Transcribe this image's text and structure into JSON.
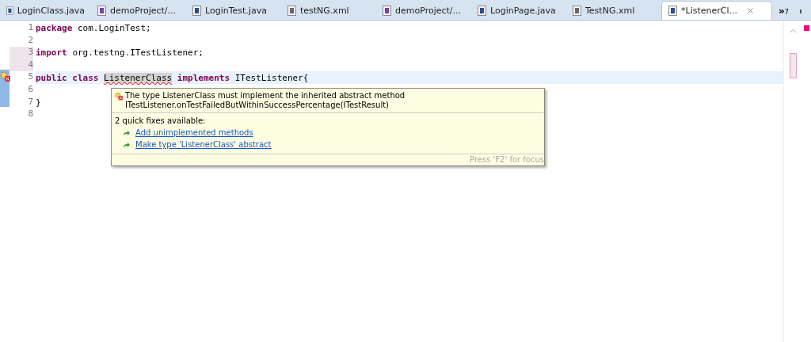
{
  "tabs": [
    {
      "label": "LoginClass.java",
      "kind": "java",
      "selected": false
    },
    {
      "label": "demoProject/...",
      "kind": "maven",
      "selected": false
    },
    {
      "label": "LoginTest.java",
      "kind": "java",
      "selected": false
    },
    {
      "label": "testNG.xml",
      "kind": "xml",
      "selected": false
    },
    {
      "label": "demoProject/...",
      "kind": "maven",
      "selected": false
    },
    {
      "label": "LoginPage.java",
      "kind": "java",
      "selected": false
    },
    {
      "label": "TestNG.xml",
      "kind": "xml",
      "selected": false
    },
    {
      "label": "*ListenerCl...",
      "kind": "java",
      "selected": true
    }
  ],
  "overflow": {
    "symbol": "»",
    "count": "7"
  },
  "lines": [
    {
      "number": "1",
      "tokens": [
        {
          "text": "package",
          "kind": "keyword"
        },
        {
          "text": "com.LoginTest;",
          "kind": "plain"
        }
      ]
    },
    {
      "number": "2"
    },
    {
      "number": "3",
      "tokens": [
        {
          "text": "import",
          "kind": "keyword"
        },
        {
          "text": "org.testng.ITestListener;",
          "kind": "plain"
        }
      ]
    },
    {
      "number": "4"
    },
    {
      "number": "5",
      "current": true,
      "error": true,
      "tokens": [
        {
          "text": "public class",
          "kind": "keyword"
        },
        {
          "text": "ListenerClass",
          "kind": "error"
        },
        {
          "text": "implements",
          "kind": "keyword"
        },
        {
          "text": "ITestListener{",
          "kind": "plain"
        }
      ]
    },
    {
      "number": "6"
    },
    {
      "number": "7",
      "tokens": [
        {
          "text": "}",
          "kind": "plain"
        }
      ]
    },
    {
      "number": "8"
    }
  ],
  "popup": {
    "message": "The type ListenerClass must implement the inherited abstract method ITestListener.onTestFailedButWithinSuccessPercentage(ITestResult)",
    "fixes_heading": "2 quick fixes available:",
    "fixes": [
      "Add unimplemented methods",
      "Make type 'ListenerClass' abstract"
    ],
    "footer": "Press 'F2' for focus"
  }
}
